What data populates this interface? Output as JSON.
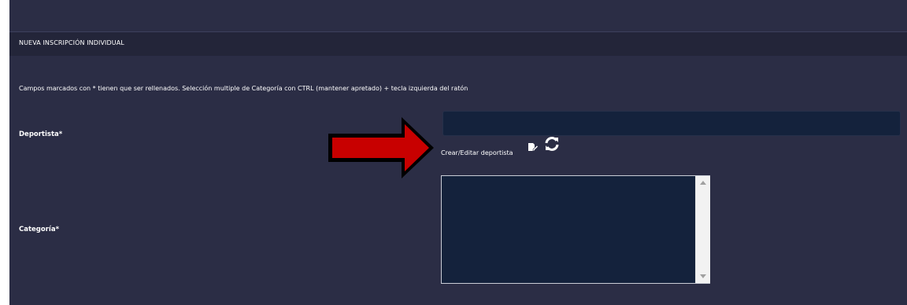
{
  "form": {
    "title": "NUEVA INSCRIPCIÓN INDIVIDUAL",
    "hint": "Campos marcados con * tienen que ser rellenados. Selección multiple de Categoría con CTRL (mantener apretado) + tecla izquierda del ratón",
    "deportista_label": "Deportista*",
    "deportista_value": "",
    "crear_editar_link": "Crear/Editar deportista",
    "categoria_label": "Categoría*",
    "categoria_options": []
  },
  "icons": {
    "edit": "edit-icon",
    "refresh": "refresh-icon"
  },
  "colors": {
    "panel_bg": "#2b2d45",
    "header_bg": "#232539",
    "field_bg": "#14223c",
    "annotation_arrow": "#c80000"
  }
}
